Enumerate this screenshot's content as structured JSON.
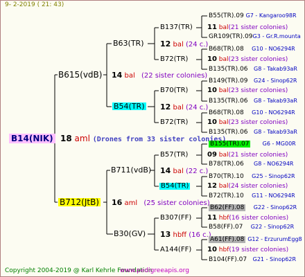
{
  "date": "9-   2-2019  ( 21:  43)",
  "root": {
    "label": "B14(NIK)",
    "num": "18",
    "suffix": "aml",
    "note": "(Drones from 33 sister colonies)"
  },
  "gen1": [
    {
      "label": "B615(vdB)",
      "num": "14",
      "suffix": "bal",
      "note": "(22 sister colonies)"
    },
    {
      "label": "B712(JtB)",
      "num": "16",
      "suffix": "aml",
      "note": "(25 sister colonies)"
    }
  ],
  "gen2": [
    {
      "label": "B63(TR)",
      "num": "12",
      "suffix": "bal",
      "note": "(24 c.)"
    },
    {
      "label": "B54(TR)",
      "num": "12",
      "suffix": "bal",
      "note": "(24 c.)"
    },
    {
      "label": "B711(vdB)",
      "num": "14",
      "suffix": "bal",
      "note": "(22 c.)"
    },
    {
      "label": "B30(GV)",
      "num": "13",
      "suffix": "hbff",
      "note": "(16 c.)"
    }
  ],
  "gen3": [
    {
      "label": "B137(TR)",
      "num": "11",
      "suffix": "bal",
      "note": "(21 sister colonies)"
    },
    {
      "label": "B72(TR)",
      "num": "10",
      "suffix": "bal",
      "note": "(23 sister colonies)"
    },
    {
      "label": "B70(TR)",
      "num": "10",
      "suffix": "bal",
      "note": "(23 sister colonies)"
    },
    {
      "label": "B72(TR)",
      "num": "10",
      "suffix": "bal",
      "note": "(23 sister colonies)"
    },
    {
      "label": "B57(TR)",
      "num": "09",
      "suffix": "bal",
      "note": "(21 sister colonies)"
    },
    {
      "label": "B54(TR)",
      "num": "12",
      "suffix": "bal",
      "note": "(24 sister colonies)"
    },
    {
      "label": "B307(FF)",
      "num": "11",
      "suffix": "hbf",
      "note": "(16 sister colonies)"
    },
    {
      "label": "A144(FF)",
      "num": "10",
      "suffix": "hbf",
      "note": "(19 sister colonies)"
    }
  ],
  "gen4": [
    {
      "label": "B55(TR).09",
      "code": "G7 - Kangaroo98R"
    },
    {
      "label": "GR109(TR).09",
      "code": "G3 - Gr.R.mounta"
    },
    {
      "label": "B68(TR).08",
      "code": "G10 - NO6294R"
    },
    {
      "label": "B135(TR).06",
      "code": "G8 - Takab93aR"
    },
    {
      "label": "B149(TR).09",
      "code": "G24 - Sinop62R"
    },
    {
      "label": "B135(TR).06",
      "code": "G8 - Takab93aR"
    },
    {
      "label": "B68(TR).08",
      "code": "G10 - NO6294R"
    },
    {
      "label": "B135(TR).06",
      "code": "G8 - Takab93aR"
    },
    {
      "label": "B155(TR).07",
      "code": "G6 - MG00R"
    },
    {
      "label": "B78(TR).06",
      "code": "G8 - NO6294R"
    },
    {
      "label": "B70(TR).10",
      "code": "G25 - Sinop62R"
    },
    {
      "label": "B72(TR).10",
      "code": "G11 - NO6294R"
    },
    {
      "label": "B62(FF).08",
      "code": "G22 - Sinop62R"
    },
    {
      "label": "B58(FF).07",
      "code": "G22 - Sinop62R"
    },
    {
      "label": "A61(FF).08",
      "code": "G12 - ErzurumEgg8"
    },
    {
      "label": "B104(FF).07",
      "code": "G21 - Sinop62R"
    }
  ],
  "footer": {
    "copyright": "Copyright 2004-2019 @ Karl Kehrle Foundation",
    "site": "www.pedigreeapis.org"
  },
  "colors": {
    "root_bg": "#ffc0ff",
    "cyan": "#00ffff",
    "yellow": "#ffff00",
    "green": "#00ee00",
    "grey": "#b0b0b0",
    "red": "#cc0000",
    "code_blue": "#0000c0"
  }
}
